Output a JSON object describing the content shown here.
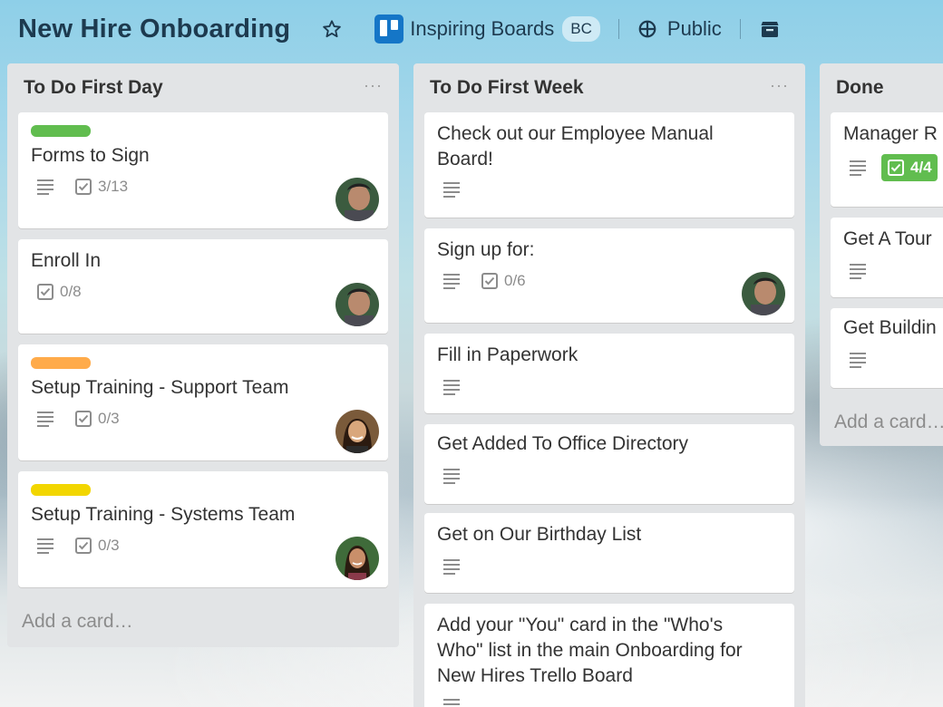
{
  "header": {
    "board_title": "New Hire Onboarding",
    "team_name": "Inspiring Boards",
    "team_badge": "BC",
    "visibility": "Public",
    "icons": [
      "star-icon",
      "trello-logo-icon",
      "globe-icon",
      "archive-icon"
    ]
  },
  "colors": {
    "label_green": "#61bd4f",
    "label_orange": "#ffab4a",
    "label_yellow": "#f2d600",
    "trello_blue": "#1576c7",
    "complete_green": "#61bd4f"
  },
  "lists": [
    {
      "title": "To Do First Day",
      "menu": "···",
      "add_card": "Add a card…",
      "cards": [
        {
          "title": "Forms to Sign",
          "checklist": "3/13"
        },
        {
          "title": "Enroll In",
          "checklist": "0/8"
        },
        {
          "title": "Setup Training - Support Team",
          "checklist": "0/3"
        },
        {
          "title": "Setup Training - Systems Team",
          "checklist": "0/3"
        }
      ]
    },
    {
      "title": "To Do First Week",
      "menu": "···",
      "cards": [
        {
          "title_line1": "Check out our Employee Manual",
          "title_line2": "Board!"
        },
        {
          "title": "Sign up for:",
          "checklist": "0/6"
        },
        {
          "title": "Fill in Paperwork"
        },
        {
          "title": "Get Added To Office Directory"
        },
        {
          "title": "Get on Our Birthday List"
        },
        {
          "title_line1": "Add your \"You\" card in the \"Who's",
          "title_line2": "Who\" list in the main Onboarding for",
          "title_line3": "New Hires Trello Board"
        }
      ]
    },
    {
      "title": "Done",
      "add_card": "Add a card…",
      "cards": [
        {
          "title": "Manager R",
          "checklist": "4/4"
        },
        {
          "title": "Get A Tour"
        },
        {
          "title": "Get Buildin"
        }
      ]
    }
  ]
}
